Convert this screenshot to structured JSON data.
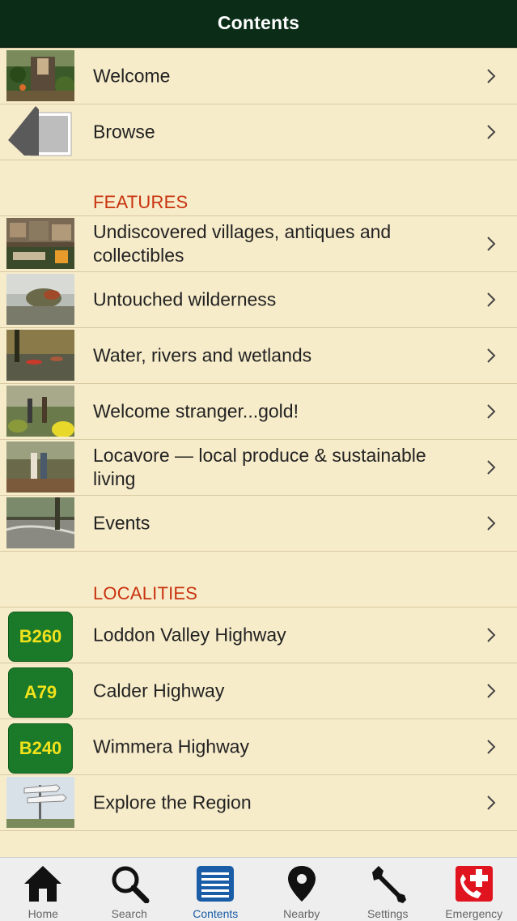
{
  "navbar": {
    "title": "Contents"
  },
  "top_items": [
    {
      "label": "Welcome"
    },
    {
      "label": "Browse"
    }
  ],
  "features": {
    "heading": "FEATURES",
    "items": [
      {
        "label": "Undiscovered villages, antiques and collectibles"
      },
      {
        "label": "Untouched wilderness"
      },
      {
        "label": "Water, rivers and wetlands"
      },
      {
        "label": "Welcome stranger...gold!"
      },
      {
        "label": "Locavore — local produce & sustainable living"
      },
      {
        "label": "Events"
      }
    ]
  },
  "localities": {
    "heading": "LOCALITIES",
    "items": [
      {
        "label": "Loddon Valley Highway",
        "badge": "B260"
      },
      {
        "label": "Calder Highway",
        "badge": "A79"
      },
      {
        "label": "Wimmera Highway",
        "badge": "B240"
      },
      {
        "label": "Explore the Region"
      }
    ]
  },
  "tabbar": {
    "tabs": [
      {
        "label": "Home",
        "icon": "house-icon"
      },
      {
        "label": "Search",
        "icon": "magnifier-icon"
      },
      {
        "label": "Contents",
        "icon": "list-icon",
        "active": true
      },
      {
        "label": "Nearby",
        "icon": "location-pin-icon"
      },
      {
        "label": "Settings",
        "icon": "wrench-icon"
      },
      {
        "label": "Emergency",
        "icon": "emergency-phone-icon"
      }
    ]
  },
  "colors": {
    "navbar_bg": "#0b2d18",
    "page_bg": "#f7ecca",
    "section_heading": "#c8320e",
    "badge_bg": "#1a7a2a",
    "badge_text": "#f2e21b",
    "tab_active": "#1a5da6"
  }
}
